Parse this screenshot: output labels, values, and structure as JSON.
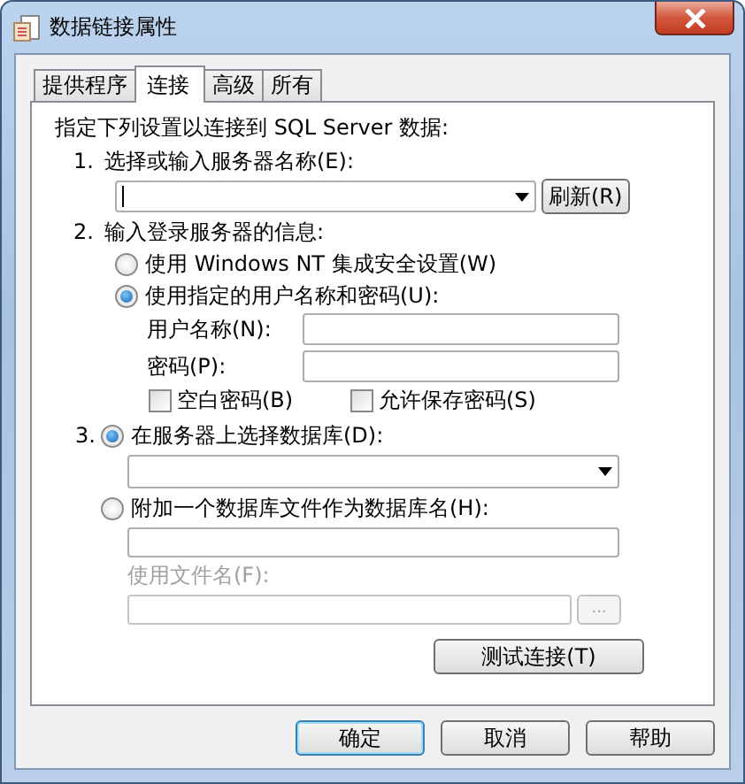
{
  "window": {
    "title": "数据链接属性"
  },
  "tabs": [
    {
      "label": "提供程序",
      "selected": false
    },
    {
      "label": "连接",
      "selected": true
    },
    {
      "label": "高级",
      "selected": false
    },
    {
      "label": "所有",
      "selected": false
    }
  ],
  "intro": "指定下列设置以连接到 SQL Server 数据:",
  "step1": {
    "number": "1.",
    "label": "选择或输入服务器名称(E):",
    "refresh_button": "刷新(R)"
  },
  "step2": {
    "number": "2.",
    "label": "输入登录服务器的信息:",
    "options": [
      {
        "label": "使用 Windows NT 集成安全设置(W)",
        "selected": false
      },
      {
        "label": "使用指定的用户名称和密码(U):",
        "selected": true
      }
    ],
    "username_label": "用户名称(N):",
    "password_label": "密码(P):",
    "checkboxes": [
      {
        "label": "空白密码(B)",
        "checked": false
      },
      {
        "label": "允许保存密码(S)",
        "checked": false
      }
    ]
  },
  "step3": {
    "number": "3.",
    "options": [
      {
        "label": "在服务器上选择数据库(D):",
        "selected": true
      },
      {
        "label": "附加一个数据库文件作为数据库名(H):",
        "selected": false
      }
    ],
    "file_name": {
      "label": "使用文件名(F):",
      "disabled": true,
      "browse_button": "..."
    },
    "test_button": "测试连接(T)"
  },
  "buttons": [
    {
      "label": "确定",
      "default": true
    },
    {
      "label": "取消",
      "default": false
    },
    {
      "label": "帮助",
      "default": false
    }
  ]
}
